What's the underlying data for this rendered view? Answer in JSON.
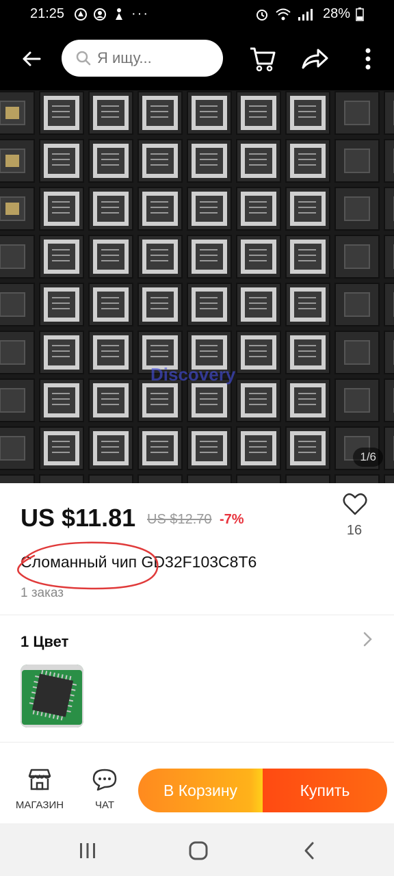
{
  "status_bar": {
    "time": "21:25",
    "battery": "28%",
    "left_icons": [
      "alert-icon",
      "account-icon",
      "figure-icon",
      "more-dots"
    ],
    "right_icons": [
      "alarm-icon",
      "wifi-icon",
      "signal-icon",
      "battery-icon"
    ]
  },
  "app_bar": {
    "search_placeholder": "Я ищу...",
    "icons": [
      "back-arrow-icon",
      "cart-icon",
      "share-icon",
      "more-vertical-icon"
    ]
  },
  "gallery": {
    "watermark": "Discovery",
    "counter": "1/6"
  },
  "product": {
    "price": "US $11.81",
    "old_price": "US $12.70",
    "discount": "-7%",
    "favorites_count": "16",
    "title": "Сломанный чип GD32F103C8T6",
    "orders": "1 заказ",
    "color_section_label": "1 Цвет"
  },
  "actions": {
    "store_label": "МАГАЗИН",
    "chat_label": "ЧАТ",
    "cart_button": "В Корзину",
    "buy_button": "Купить"
  },
  "colors": {
    "accent_orange": "#ff8a1f",
    "buy_red": "#ff4a12",
    "discount_red": "#e8323c",
    "annotation_red": "#e03a3a"
  }
}
